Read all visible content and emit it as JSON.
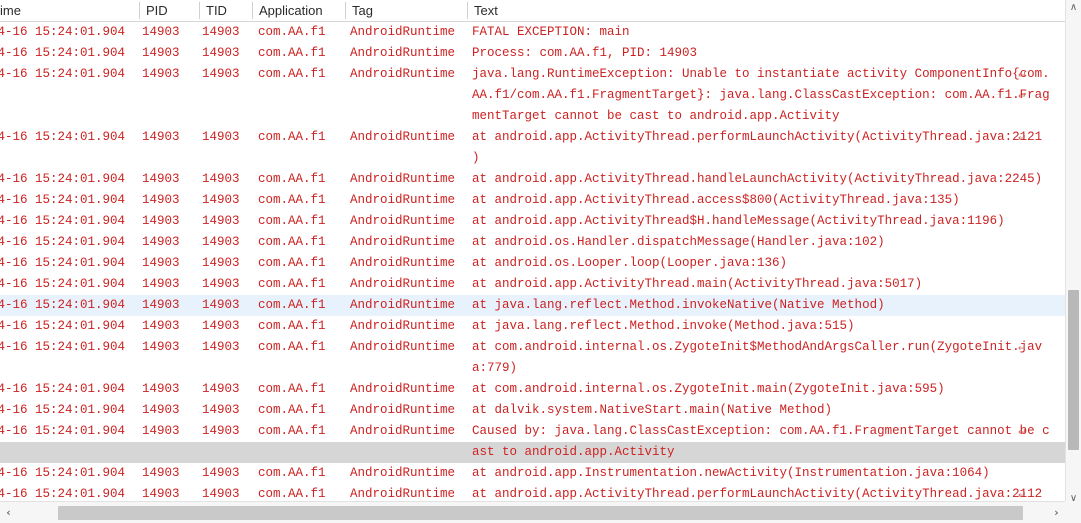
{
  "window": {
    "title": "Logcat",
    "text_color": "#cc2222",
    "selected_row_color": "#e8f2fc",
    "hovered_row_color": "#d6d6d6",
    "header_text_color": "#2b2b2b"
  },
  "columns": [
    {
      "key": "time",
      "label": "ime"
    },
    {
      "key": "pid",
      "label": "PID"
    },
    {
      "key": "tid",
      "label": "TID"
    },
    {
      "key": "application",
      "label": "Application"
    },
    {
      "key": "tag",
      "label": "Tag"
    },
    {
      "key": "text",
      "label": "Text"
    }
  ],
  "common": {
    "time": "04-16 15:24:01.904",
    "pid": "14903",
    "tid": "14903",
    "application": "com.AA.f1",
    "tag": "AndroidRuntime"
  },
  "wrap_marker": "↵",
  "rows": [
    {
      "lead": true,
      "text": "FATAL EXCEPTION: main",
      "wrap": false,
      "state": ""
    },
    {
      "lead": true,
      "text": "Process: com.AA.f1, PID: 14903",
      "wrap": false,
      "state": ""
    },
    {
      "lead": true,
      "text": "java.lang.RuntimeException: Unable to instantiate activity ComponentInfo{com.",
      "wrap": true,
      "state": ""
    },
    {
      "lead": false,
      "text": "AA.f1/com.AA.f1.FragmentTarget}: java.lang.ClassCastException: com.AA.f1.Frag",
      "wrap": true,
      "state": ""
    },
    {
      "lead": false,
      "text": "mentTarget cannot be cast to android.app.Activity",
      "wrap": false,
      "state": ""
    },
    {
      "lead": true,
      "text": "at android.app.ActivityThread.performLaunchActivity(ActivityThread.java:2121",
      "wrap": true,
      "state": ""
    },
    {
      "lead": false,
      "text": ")",
      "wrap": false,
      "state": ""
    },
    {
      "lead": true,
      "text": "at android.app.ActivityThread.handleLaunchActivity(ActivityThread.java:2245)",
      "wrap": false,
      "state": ""
    },
    {
      "lead": true,
      "text": "at android.app.ActivityThread.access$800(ActivityThread.java:135)",
      "wrap": false,
      "state": ""
    },
    {
      "lead": true,
      "text": "at android.app.ActivityThread$H.handleMessage(ActivityThread.java:1196)",
      "wrap": false,
      "state": ""
    },
    {
      "lead": true,
      "text": "at android.os.Handler.dispatchMessage(Handler.java:102)",
      "wrap": false,
      "state": ""
    },
    {
      "lead": true,
      "text": "at android.os.Looper.loop(Looper.java:136)",
      "wrap": false,
      "state": ""
    },
    {
      "lead": true,
      "text": "at android.app.ActivityThread.main(ActivityThread.java:5017)",
      "wrap": false,
      "state": ""
    },
    {
      "lead": true,
      "text": "at java.lang.reflect.Method.invokeNative(Native Method)",
      "wrap": false,
      "state": "sel"
    },
    {
      "lead": true,
      "text": "at java.lang.reflect.Method.invoke(Method.java:515)",
      "wrap": false,
      "state": ""
    },
    {
      "lead": true,
      "text": "at com.android.internal.os.ZygoteInit$MethodAndArgsCaller.run(ZygoteInit.jav",
      "wrap": true,
      "state": ""
    },
    {
      "lead": false,
      "text": "a:779)",
      "wrap": false,
      "state": ""
    },
    {
      "lead": true,
      "text": "at com.android.internal.os.ZygoteInit.main(ZygoteInit.java:595)",
      "wrap": false,
      "state": ""
    },
    {
      "lead": true,
      "text": "at dalvik.system.NativeStart.main(Native Method)",
      "wrap": false,
      "state": ""
    },
    {
      "lead": true,
      "text": "Caused by: java.lang.ClassCastException: com.AA.f1.FragmentTarget cannot be c",
      "wrap": true,
      "state": ""
    },
    {
      "lead": false,
      "text": "ast to android.app.Activity",
      "wrap": false,
      "state": "hov"
    },
    {
      "lead": true,
      "text": "at android.app.Instrumentation.newActivity(Instrumentation.java:1064)",
      "wrap": false,
      "state": ""
    },
    {
      "lead": true,
      "text": "at android.app.ActivityThread.performLaunchActivity(ActivityThread.java:2112",
      "wrap": true,
      "state": ""
    }
  ],
  "scrollbars": {
    "vertical": {
      "up_arrow": "∧",
      "down_arrow": "∨"
    },
    "horizontal": {
      "left_arrow": "‹",
      "right_arrow": "›"
    }
  }
}
